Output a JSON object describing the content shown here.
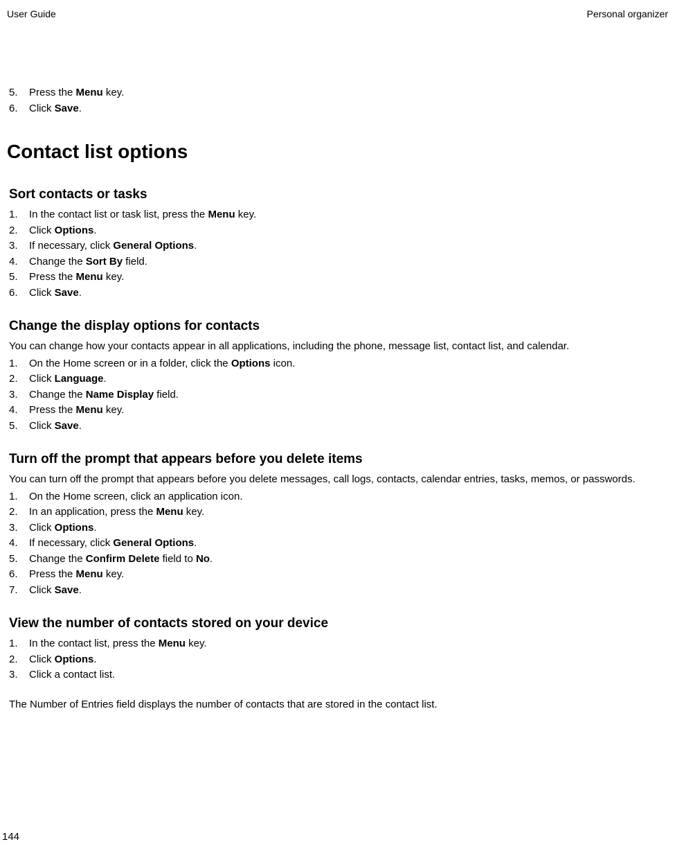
{
  "header": {
    "left": "User Guide",
    "right": "Personal organizer"
  },
  "top_list": [
    {
      "num": "5.",
      "prefix": "Press the ",
      "bold": "Menu",
      "suffix": " key."
    },
    {
      "num": "6.",
      "prefix": "Click ",
      "bold": "Save",
      "suffix": "."
    }
  ],
  "main_heading": "Contact list options",
  "sections": [
    {
      "title": "Sort contacts or tasks",
      "intro": "",
      "items": [
        {
          "num": "1.",
          "prefix": "In the contact list or task list, press the ",
          "bold": "Menu",
          "suffix": " key."
        },
        {
          "num": "2.",
          "prefix": "Click ",
          "bold": "Options",
          "suffix": "."
        },
        {
          "num": "3.",
          "prefix": "If necessary, click ",
          "bold": "General Options",
          "suffix": "."
        },
        {
          "num": "4.",
          "prefix": "Change the ",
          "bold": "Sort By",
          "suffix": " field."
        },
        {
          "num": "5.",
          "prefix": "Press the ",
          "bold": "Menu",
          "suffix": " key."
        },
        {
          "num": "6.",
          "prefix": "Click ",
          "bold": "Save",
          "suffix": "."
        }
      ],
      "footer": ""
    },
    {
      "title": "Change the display options for contacts",
      "intro": "You can change how your contacts appear in all applications, including the phone, message list, contact list, and calendar.",
      "items": [
        {
          "num": "1.",
          "prefix": "On the Home screen or in a folder, click the ",
          "bold": "Options",
          "suffix": " icon."
        },
        {
          "num": "2.",
          "prefix": "Click ",
          "bold": "Language",
          "suffix": "."
        },
        {
          "num": "3.",
          "prefix": "Change the ",
          "bold": "Name Display",
          "suffix": " field."
        },
        {
          "num": "4.",
          "prefix": "Press the ",
          "bold": "Menu",
          "suffix": " key."
        },
        {
          "num": "5.",
          "prefix": "Click ",
          "bold": "Save",
          "suffix": "."
        }
      ],
      "footer": ""
    },
    {
      "title": "Turn off the prompt that appears before you delete items",
      "intro": "You can turn off the prompt that appears before you delete messages, call logs, contacts, calendar entries, tasks, memos, or passwords.",
      "items": [
        {
          "num": "1.",
          "prefix": "On the Home screen, click an application icon.",
          "bold": "",
          "suffix": ""
        },
        {
          "num": "2.",
          "prefix": "In an application, press the ",
          "bold": "Menu",
          "suffix": " key."
        },
        {
          "num": "3.",
          "prefix": "Click ",
          "bold": "Options",
          "suffix": "."
        },
        {
          "num": "4.",
          "prefix": "If necessary, click ",
          "bold": "General Options",
          "suffix": "."
        },
        {
          "num": "5.",
          "prefix": "Change the ",
          "bold": "Confirm Delete",
          "suffix": " field to ",
          "bold2": "No",
          "suffix2": "."
        },
        {
          "num": "6.",
          "prefix": "Press the ",
          "bold": "Menu",
          "suffix": " key."
        },
        {
          "num": "7.",
          "prefix": "Click ",
          "bold": "Save",
          "suffix": "."
        }
      ],
      "footer": ""
    },
    {
      "title": "View the number of contacts stored on your device",
      "intro": "",
      "items": [
        {
          "num": "1.",
          "prefix": "In the contact list, press the ",
          "bold": "Menu",
          "suffix": " key."
        },
        {
          "num": "2.",
          "prefix": "Click ",
          "bold": "Options",
          "suffix": "."
        },
        {
          "num": "3.",
          "prefix": "Click a contact list.",
          "bold": "",
          "suffix": ""
        }
      ],
      "footer": "The Number of Entries field displays the number of contacts that are stored in the contact list."
    }
  ],
  "page_number": "144"
}
